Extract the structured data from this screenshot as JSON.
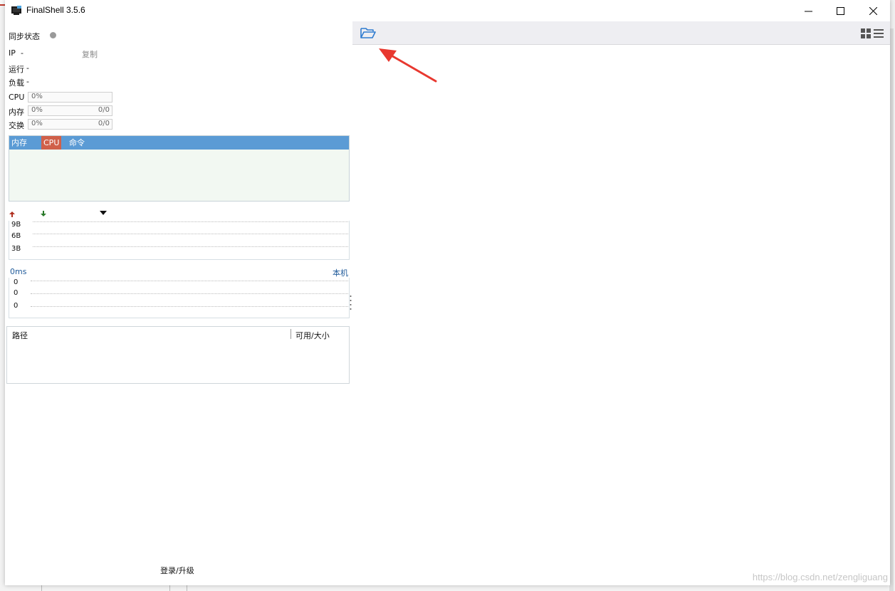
{
  "window": {
    "title": "FinalShell 3.5.6",
    "controls": [
      "minimize",
      "maximize",
      "close"
    ]
  },
  "status": {
    "sync_label": "同步状态",
    "ip_label": "IP",
    "ip_value": "-",
    "copy_label": "复制",
    "uptime_label": "运行",
    "uptime_value": "-",
    "load_label": "负载",
    "load_value": "-"
  },
  "meters": [
    {
      "label": "CPU",
      "percent": "0%",
      "ratio": ""
    },
    {
      "label": "内存",
      "percent": "0%",
      "ratio": "0/0"
    },
    {
      "label": "交换",
      "percent": "0%",
      "ratio": "0/0"
    }
  ],
  "monitor_tabs": [
    {
      "label": "内存",
      "active": false
    },
    {
      "label": "CPU",
      "active": true
    },
    {
      "label": "命令",
      "active": false
    }
  ],
  "network": {
    "upload_icon": "arrow-up-icon",
    "download_icon": "arrow-down-icon",
    "dropdown_icon": "dropdown-triangle-icon",
    "axis": [
      "9B",
      "6B",
      "3B"
    ]
  },
  "latency": {
    "value": "0ms",
    "target": "本机",
    "axis": [
      "0",
      "0",
      "0"
    ]
  },
  "filesystem": {
    "col_path": "路径",
    "col_size": "可用/大小"
  },
  "login_label": "登录/升级",
  "toolbar": {
    "open_folder_icon": "folder-open-icon",
    "grid_icon": "grid-view-icon",
    "list_icon": "list-view-icon"
  },
  "watermark": "https://blog.csdn.net/zengliguang",
  "colors": {
    "accent": "#5b9bd5",
    "active_tab": "#d0604a",
    "annotation_arrow": "#e8382f"
  }
}
